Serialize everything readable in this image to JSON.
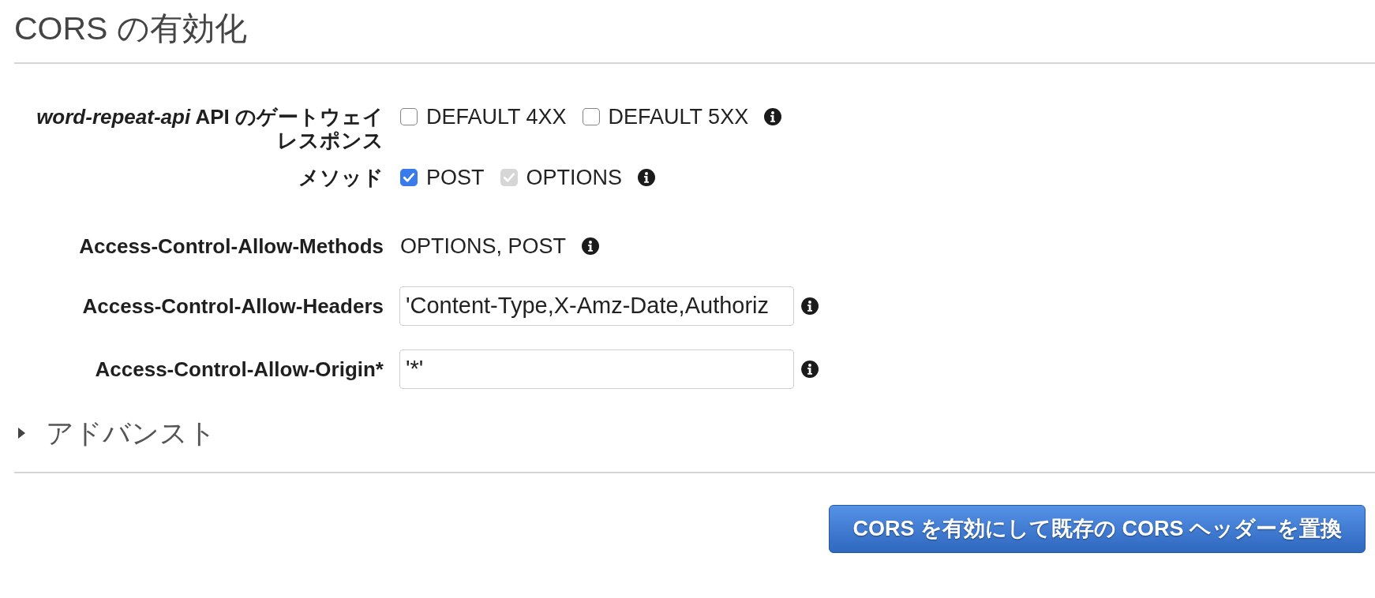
{
  "title": "CORS の有効化",
  "form": {
    "rows": [
      {
        "kind": "checkboxes",
        "label": "*word-repeat-api* API のゲートウェイレスポンス",
        "options": [
          {
            "label": "DEFAULT 4XX",
            "checked": false,
            "disabled": false
          },
          {
            "label": "DEFAULT 5XX",
            "checked": false,
            "disabled": false
          }
        ]
      },
      {
        "kind": "checkboxes",
        "label": "メソッド",
        "options": [
          {
            "label": "POST",
            "checked": true,
            "disabled": false
          },
          {
            "label": "OPTIONS",
            "checked": true,
            "disabled": true
          }
        ]
      },
      {
        "kind": "text",
        "label": "Access-Control-Allow-Methods",
        "value": "OPTIONS, POST"
      },
      {
        "kind": "input",
        "label": "Access-Control-Allow-Headers",
        "value": "'Content-Type,X-Amz-Date,Authoriz"
      },
      {
        "kind": "input",
        "label": "Access-Control-Allow-Origin*",
        "value": "'*'"
      }
    ]
  },
  "advanced": {
    "label": "アドバンスト",
    "expanded": false
  },
  "submit_button": {
    "label": "CORS を有効にして既存の CORS ヘッダーを置換"
  }
}
